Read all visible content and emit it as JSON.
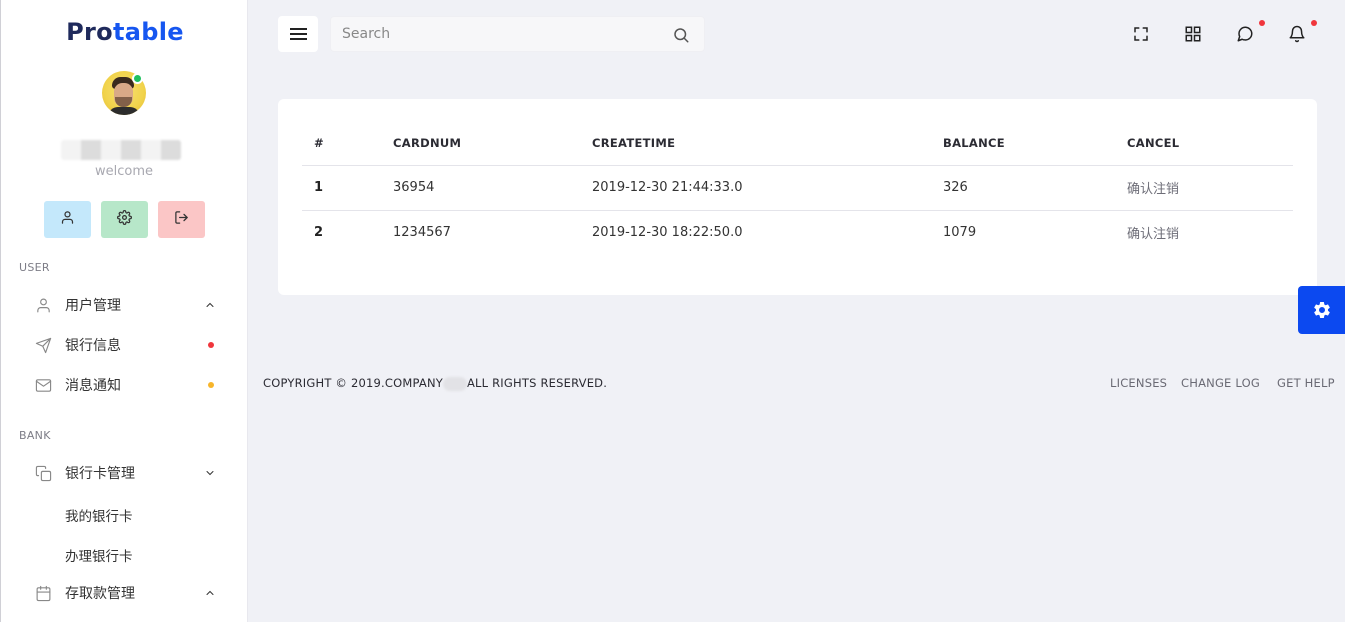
{
  "brand": {
    "part1": "Pro",
    "part2": "table"
  },
  "profile": {
    "greeting": "welcome",
    "status_color": "#1fc05e"
  },
  "quick_actions": [
    {
      "name": "profile",
      "icon": "user-icon",
      "color": "#c4e8fb"
    },
    {
      "name": "settings",
      "icon": "gear-icon",
      "color": "#b7e7c9"
    },
    {
      "name": "logout",
      "icon": "logout-icon",
      "color": "#fbc6c6"
    }
  ],
  "sidebar": {
    "sections": [
      {
        "label": "USER",
        "items": [
          {
            "label": "用户管理",
            "icon": "user-icon",
            "chevron": "up"
          },
          {
            "label": "银行信息",
            "icon": "send-icon",
            "dot_color": "#f0363c"
          },
          {
            "label": "消息通知",
            "icon": "mail-icon",
            "dot_color": "#f7b52b"
          }
        ]
      },
      {
        "label": "BANK",
        "items": [
          {
            "label": "银行卡管理",
            "icon": "copy-icon",
            "chevron": "down",
            "children": [
              "我的银行卡",
              "办理银行卡"
            ]
          },
          {
            "label": "存取款管理",
            "icon": "calendar-icon",
            "chevron": "up"
          }
        ]
      }
    ]
  },
  "topbar": {
    "search_placeholder": "Search",
    "icons": [
      "fullscreen-icon",
      "apps-grid-icon",
      "chat-icon",
      "bell-icon"
    ]
  },
  "table": {
    "headers": [
      "#",
      "CARDNUM",
      "CREATETIME",
      "BALANCE",
      "CANCEL"
    ],
    "rows": [
      {
        "index": "1",
        "cardnum": "36954",
        "createtime": "2019-12-30 21:44:33.0",
        "balance": "326",
        "cancel": "确认注销"
      },
      {
        "index": "2",
        "cardnum": "1234567",
        "createtime": "2019-12-30 18:22:50.0",
        "balance": "1079",
        "cancel": "确认注销"
      }
    ]
  },
  "footer": {
    "copyright_pre": "COPYRIGHT © 2019.COMPANY",
    "copyright_post": "ALL RIGHTS RESERVED.",
    "links": [
      "LICENSES",
      "CHANGE LOG",
      "GET HELP"
    ]
  },
  "colors": {
    "accent": "#1656f0",
    "brand_dark": "#1f2a5c",
    "settings_fab": "#0c49f0",
    "notify": "#f0363c"
  }
}
